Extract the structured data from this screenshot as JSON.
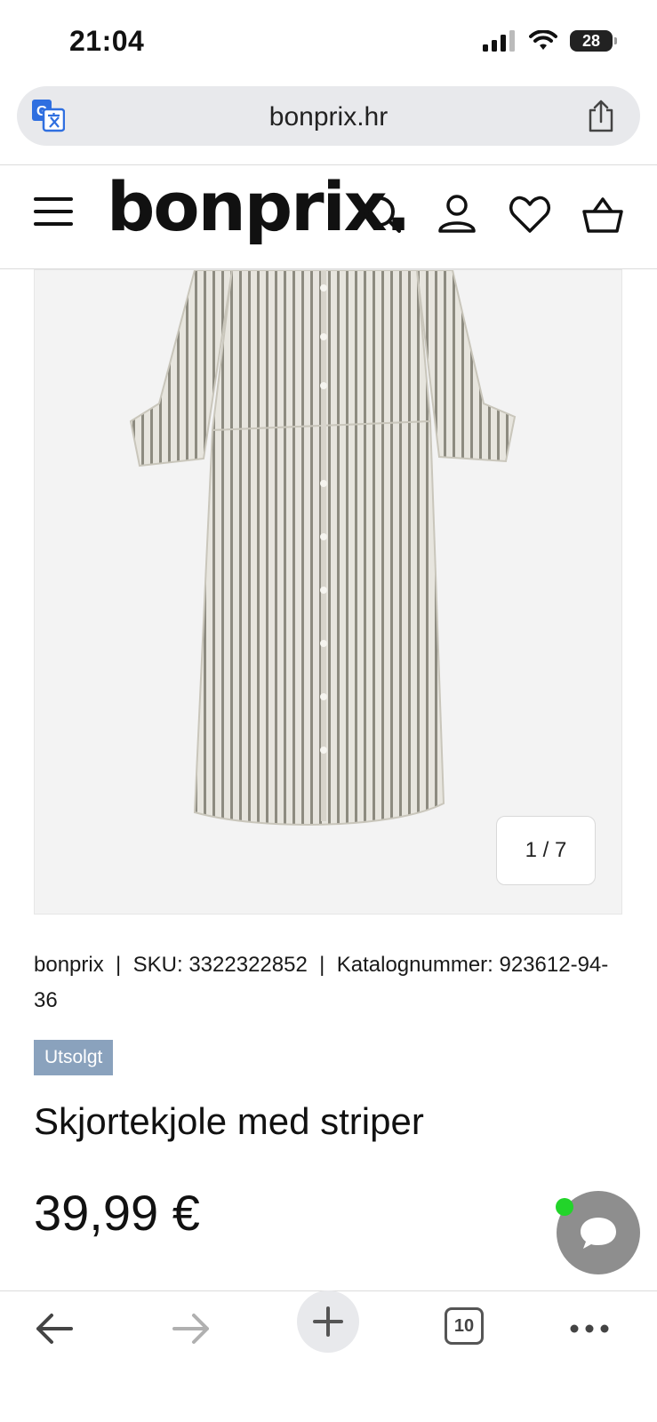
{
  "status_bar": {
    "time": "21:04",
    "battery": "28"
  },
  "browser": {
    "url": "bonprix.hr",
    "tab_count": "10"
  },
  "header": {
    "logo": "bonprix."
  },
  "product": {
    "image_counter": "1 / 7",
    "brand": "bonprix",
    "sku": "SKU: 3322322852",
    "catalog": "Katalognummer: 923612-94-36",
    "badge": "Utsolgt",
    "title": "Skjortekjole med striper",
    "price": "39,99 €"
  },
  "colors": {
    "badge_bg": "#8aa2bd",
    "chat_online": "#22d42a"
  }
}
